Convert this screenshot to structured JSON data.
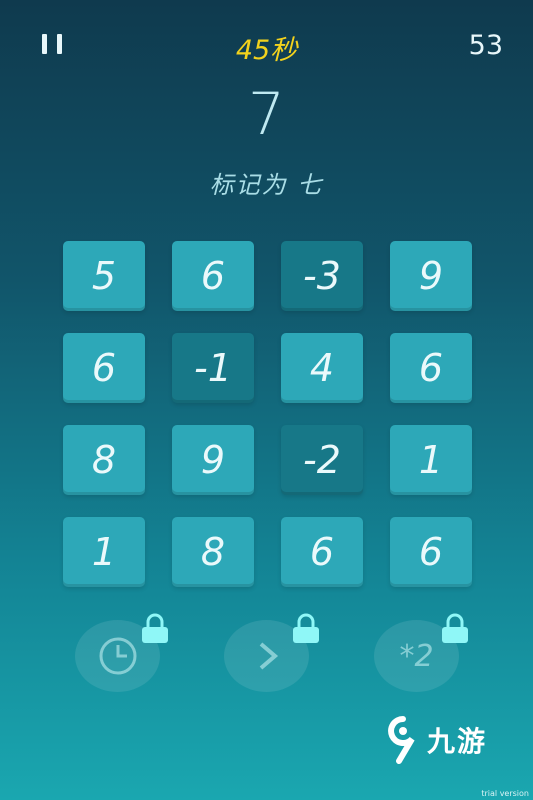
{
  "header": {
    "timer": "45秒",
    "score": "53"
  },
  "target_number": "7",
  "instruction": "标记为 七",
  "grid": [
    [
      {
        "value": "5",
        "shade": "light"
      },
      {
        "value": "6",
        "shade": "light"
      },
      {
        "value": "-3",
        "shade": "dark"
      },
      {
        "value": "9",
        "shade": "light"
      }
    ],
    [
      {
        "value": "6",
        "shade": "light"
      },
      {
        "value": "-1",
        "shade": "dark"
      },
      {
        "value": "4",
        "shade": "light"
      },
      {
        "value": "6",
        "shade": "light"
      }
    ],
    [
      {
        "value": "8",
        "shade": "light"
      },
      {
        "value": "9",
        "shade": "light"
      },
      {
        "value": "-2",
        "shade": "dark"
      },
      {
        "value": "1",
        "shade": "light"
      }
    ],
    [
      {
        "value": "1",
        "shade": "light"
      },
      {
        "value": "8",
        "shade": "light"
      },
      {
        "value": "6",
        "shade": "light"
      },
      {
        "value": "6",
        "shade": "light"
      }
    ]
  ],
  "powerups": [
    {
      "icon": "clock-icon",
      "locked": true
    },
    {
      "icon": "chevron-right-icon",
      "locked": true
    },
    {
      "icon": "double-icon",
      "label": "*2",
      "locked": true
    }
  ],
  "watermark": {
    "brand": "九游",
    "trial": "trial version"
  },
  "colors": {
    "timer": "#f2d21d",
    "tile_light": "#2da8b8",
    "tile_dark": "#177888",
    "lock_glow": "#8ff7f7"
  }
}
